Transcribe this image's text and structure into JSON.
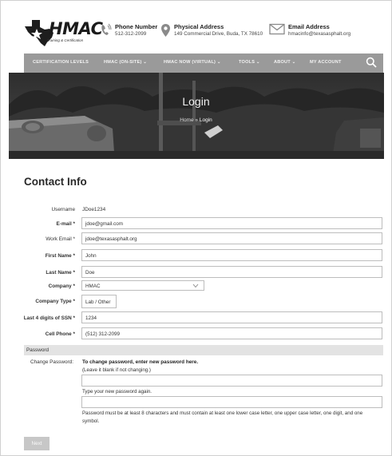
{
  "header": {
    "brand": "HMAC",
    "brand_tagline": "Training & Certification",
    "phone": {
      "label": "Phone Number",
      "value": "512-312-2099"
    },
    "address": {
      "label": "Physical Address",
      "value": "149 Commercial Drive, Buda, TX 78610"
    },
    "email": {
      "label": "Email Address",
      "value": "hmacinfo@texasasphalt.org"
    }
  },
  "nav": {
    "items": [
      {
        "label": "CERTIFICATION LEVELS"
      },
      {
        "label": "HMAC (ON-SITE) ⌄"
      },
      {
        "label": "HMAC NOW (VIRTUAL) ⌄"
      },
      {
        "label": "TOOLS ⌄"
      },
      {
        "label": "ABOUT ⌄"
      },
      {
        "label": "MY ACCOUNT"
      }
    ]
  },
  "hero": {
    "title": "Login",
    "breadcrumb_home": "Home",
    "breadcrumb_sep": "»",
    "breadcrumb_current": "Login"
  },
  "form": {
    "section_title": "Contact Info",
    "username": {
      "label": "Username",
      "value": "JDoe1234"
    },
    "email": {
      "label": "E-mail *",
      "value": "jdoe@gmail.com"
    },
    "work_email": {
      "label": "Work Email *",
      "value": "jdoe@texasasphalt.org"
    },
    "first_name": {
      "label": "First Name *",
      "value": "John"
    },
    "last_name": {
      "label": "Last Name *",
      "value": "Doe"
    },
    "company": {
      "label": "Company *",
      "value": "HMAC"
    },
    "company_type": {
      "label": "Company Type *",
      "value": "Lab / Other"
    },
    "ssn_last4": {
      "label": "Last 4 digits of SSN *",
      "value": "1234"
    },
    "cell_phone": {
      "label": "Cell Phone *",
      "value": "(512) 312-2099"
    }
  },
  "password": {
    "section_label": "Password",
    "field_label": "Change Password:",
    "heading": "To change password, enter new password here.",
    "hint": "(Leave it blank if not changing.)",
    "confirm_label": "Type your new password again.",
    "rules": "Password must be at least 8 characters and must contain at least one lower case letter, one upper case letter, one digit, and one symbol."
  },
  "actions": {
    "next_label": "Next"
  }
}
